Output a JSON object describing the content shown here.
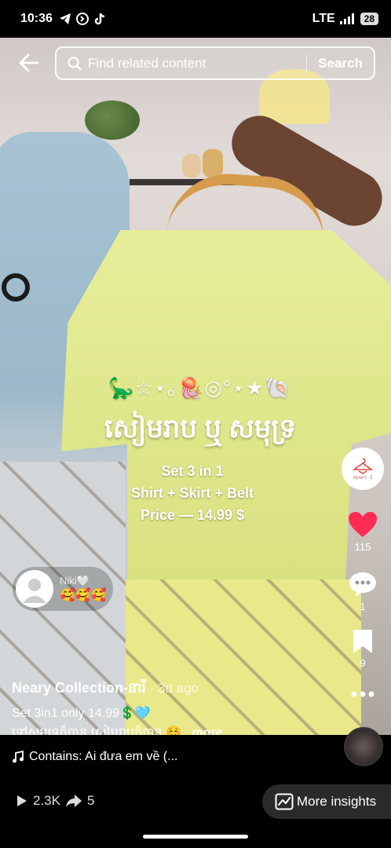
{
  "status_bar": {
    "time": "10:36",
    "network": "LTE",
    "battery": "28"
  },
  "search": {
    "placeholder": "Find related content",
    "button_label": "Search"
  },
  "overlay": {
    "emoji_line": "🦕☆⋆｡🪼◎°⋆★🐚",
    "khmer_title": "សៀមរាប ឬ សមុទ្រ",
    "line1": "Set 3 in 1",
    "line2": "Shirt + Skirt + Belt",
    "line3": "Price — 14.99 $"
  },
  "comment": {
    "name": "Niki🤍",
    "text": "🥰🥰🥰"
  },
  "rail": {
    "brand_name": "NEARY - ធី",
    "likes": "115",
    "comments": "1",
    "saves": "9"
  },
  "post": {
    "username": "Neary Collection-នារី",
    "time_ago": " · 3d ago",
    "caption_line1": "Set 3in1 only 14.99💲🩵",
    "caption_line2": "ទៅសមុទ្រក៏បាន សៀមរាបក៏បាន ☺️...",
    "more_label": "more",
    "music": "Contains: Ai đưa em về (..."
  },
  "bottom": {
    "plays": "2.3K",
    "shares": "5",
    "insights_label": "More insights"
  },
  "colors": {
    "like_red": "#fe2c55",
    "shirt_yellow": "#e1e88d"
  }
}
